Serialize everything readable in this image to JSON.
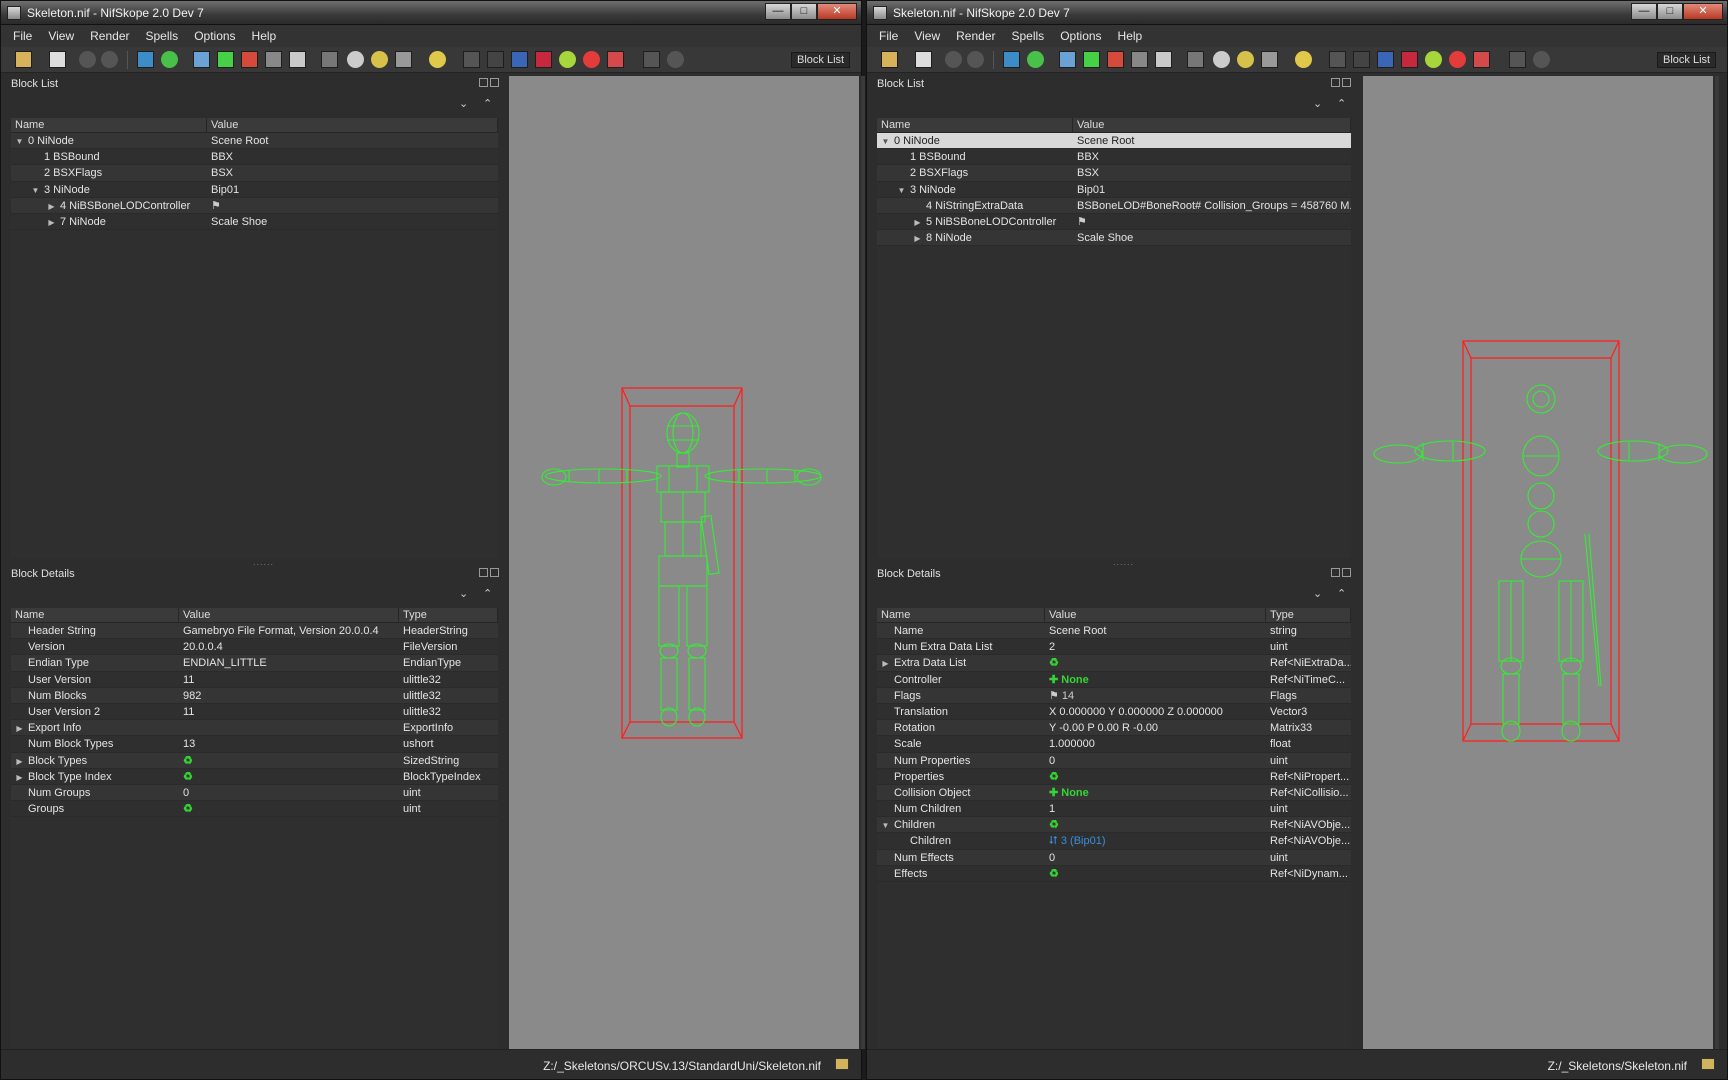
{
  "windows": [
    {
      "id": "left",
      "title": "Skeleton.nif - NifSkope 2.0 Dev 7",
      "window_controls": {
        "minimize": "—",
        "maximize": "□",
        "close": "✕"
      },
      "menu": [
        "File",
        "View",
        "Render",
        "Spells",
        "Options",
        "Help"
      ],
      "toolbar_label": "Block List",
      "block_list": {
        "title": "Block List",
        "sort_buttons": [
          "⌄",
          "⌃"
        ],
        "columns": [
          "Name",
          "Value"
        ],
        "rows": [
          {
            "arrow": "▼",
            "name": "0 NiNode",
            "value": "Scene Root",
            "indent": 0
          },
          {
            "arrow": "",
            "name": "1 BSBound",
            "value": "BBX",
            "indent": 1
          },
          {
            "arrow": "",
            "name": "2 BSXFlags",
            "value": "BSX",
            "indent": 1
          },
          {
            "arrow": "▼",
            "name": "3 NiNode",
            "value": "Bip01",
            "indent": 1
          },
          {
            "arrow": "▶",
            "name": "4 NiBSBoneLODController",
            "value": "⚑",
            "indent": 2
          },
          {
            "arrow": "▶",
            "name": "7 NiNode",
            "value": "Scale Shoe",
            "indent": 2
          }
        ]
      },
      "splitter": "......",
      "block_details": {
        "title": "Block Details",
        "sort_buttons": [
          "⌄",
          "⌃"
        ],
        "columns": [
          "Name",
          "Value",
          "Type"
        ],
        "rows": [
          {
            "arrow": "",
            "name": "Header String",
            "value": "Gamebryo File Format, Version 20.0.0.4",
            "type": "HeaderString"
          },
          {
            "arrow": "",
            "name": "Version",
            "value": "20.0.0.4",
            "type": "FileVersion"
          },
          {
            "arrow": "",
            "name": "Endian Type",
            "value": "ENDIAN_LITTLE",
            "type": "EndianType"
          },
          {
            "arrow": "",
            "name": "User Version",
            "value": "11",
            "type": "ulittle32"
          },
          {
            "arrow": "",
            "name": "Num Blocks",
            "value": "982",
            "type": "ulittle32"
          },
          {
            "arrow": "",
            "name": "User Version 2",
            "value": "11",
            "type": "ulittle32"
          },
          {
            "arrow": "▶",
            "name": "Export Info",
            "value": "",
            "type": "ExportInfo"
          },
          {
            "arrow": "",
            "name": "Num Block Types",
            "value": "13",
            "type": "ushort"
          },
          {
            "arrow": "▶",
            "name": "Block Types",
            "value": "♻",
            "type": "SizedString"
          },
          {
            "arrow": "▶",
            "name": "Block Type Index",
            "value": "♻",
            "type": "BlockTypeIndex"
          },
          {
            "arrow": "",
            "name": "Num Groups",
            "value": "0",
            "type": "uint"
          },
          {
            "arrow": "",
            "name": "Groups",
            "value": "♻",
            "type": "uint"
          }
        ]
      },
      "status_path": "Z:/_Skeletons/ORCUSv.13/StandardUni/Skeleton.nif"
    },
    {
      "id": "right",
      "title": "Skeleton.nif - NifSkope 2.0 Dev 7",
      "window_controls": {
        "minimize": "—",
        "maximize": "□",
        "close": "✕"
      },
      "menu": [
        "File",
        "View",
        "Render",
        "Spells",
        "Options",
        "Help"
      ],
      "toolbar_label": "Block List",
      "block_list": {
        "title": "Block List",
        "sort_buttons": [
          "⌄",
          "⌃"
        ],
        "columns": [
          "Name",
          "Value"
        ],
        "rows": [
          {
            "arrow": "▼",
            "name": "0 NiNode",
            "value": "Scene Root",
            "indent": 0,
            "selected": true
          },
          {
            "arrow": "",
            "name": "1 BSBound",
            "value": "BBX",
            "indent": 1
          },
          {
            "arrow": "",
            "name": "2 BSXFlags",
            "value": "BSX",
            "indent": 1
          },
          {
            "arrow": "▼",
            "name": "3 NiNode",
            "value": "Bip01",
            "indent": 1
          },
          {
            "arrow": "",
            "name": "4 NiStringExtraData",
            "value": "BSBoneLOD#BoneRoot#  Collision_Groups = 458760  M...",
            "indent": 2
          },
          {
            "arrow": "▶",
            "name": "5 NiBSBoneLODController",
            "value": "⚑",
            "indent": 2
          },
          {
            "arrow": "▶",
            "name": "8 NiNode",
            "value": "Scale Shoe",
            "indent": 2
          }
        ]
      },
      "splitter": "......",
      "block_details": {
        "title": "Block Details",
        "sort_buttons": [
          "⌄",
          "⌃"
        ],
        "columns": [
          "Name",
          "Value",
          "Type"
        ],
        "rows": [
          {
            "arrow": "",
            "name": "Name",
            "value": "Scene Root",
            "type": "string"
          },
          {
            "arrow": "",
            "name": "Num Extra Data List",
            "value": "2",
            "type": "uint"
          },
          {
            "arrow": "▶",
            "name": "Extra Data List",
            "value": "♻",
            "type": "Ref<NiExtraDa..."
          },
          {
            "arrow": "",
            "name": "Controller",
            "value": "✚ None",
            "type": "Ref<NiTimeC..."
          },
          {
            "arrow": "",
            "name": "Flags",
            "value": "⚑ 14",
            "type": "Flags"
          },
          {
            "arrow": "",
            "name": "Translation",
            "value": "X 0.000000 Y 0.000000 Z 0.000000",
            "type": "Vector3"
          },
          {
            "arrow": "",
            "name": "Rotation",
            "value": "Y -0.00 P 0.00 R -0.00",
            "type": "Matrix33"
          },
          {
            "arrow": "",
            "name": "Scale",
            "value": "1.000000",
            "type": "float"
          },
          {
            "arrow": "",
            "name": "Num Properties",
            "value": "0",
            "type": "uint"
          },
          {
            "arrow": "",
            "name": "Properties",
            "value": "♻",
            "type": "Ref<NiPropert..."
          },
          {
            "arrow": "",
            "name": "Collision Object",
            "value": "✚ None",
            "type": "Ref<NiCollisio..."
          },
          {
            "arrow": "",
            "name": "Num Children",
            "value": "1",
            "type": "uint"
          },
          {
            "arrow": "▼",
            "name": "Children",
            "value": "♻",
            "type": "Ref<NiAVObje..."
          },
          {
            "arrow": "",
            "name": "Children",
            "value": "⮃ 3 (Bip01)",
            "type": "Ref<NiAVObje...",
            "indent": 1
          },
          {
            "arrow": "",
            "name": "Num Effects",
            "value": "0",
            "type": "uint"
          },
          {
            "arrow": "",
            "name": "Effects",
            "value": "♻",
            "type": "Ref<NiDynam..."
          }
        ]
      },
      "status_path": "Z:/_Skeletons/Skeleton.nif"
    }
  ],
  "colors": {
    "wireframe": "#33ee33",
    "bounding_box": "#ff2020",
    "viewport_bg": "#8a8a8a",
    "selection": "#d8d8d8"
  }
}
